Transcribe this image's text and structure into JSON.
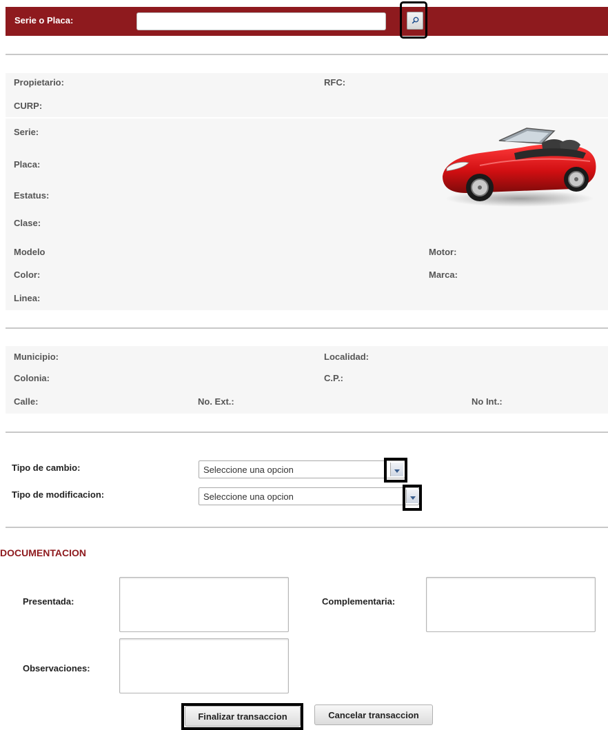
{
  "search": {
    "label": "Serie o Placa:",
    "value": "",
    "placeholder": "",
    "button_icon": "search-icon"
  },
  "owner": {
    "propietario": "Propietario:",
    "rfc": "RFC:",
    "curp": "CURP:"
  },
  "vehicle": {
    "serie": "Serie:",
    "placa": "Placa:",
    "estatus": "Estatus:",
    "clase": "Clase:",
    "modelo": "Modelo",
    "motor": "Motor:",
    "color": "Color:",
    "marca": "Marca:",
    "linea": "Linea:",
    "image": "red-convertible-car"
  },
  "address": {
    "municipio": "Municipio:",
    "localidad": "Localidad:",
    "colonia": "Colonia:",
    "cp": "C.P.:",
    "calle": "Calle:",
    "no_ext": "No. Ext.:",
    "no_int": "No Int.:"
  },
  "form": {
    "tipo_cambio_label": "Tipo de cambio:",
    "tipo_cambio_value": "Seleccione una opcion",
    "tipo_modificacion_label": "Tipo de modificacion:",
    "tipo_modificacion_value": "Seleccione una opcion"
  },
  "documentacion": {
    "title": "DOCUMENTACION",
    "presentada": "Presentada:",
    "complementaria": "Complementaria:",
    "observaciones": "Observaciones:"
  },
  "buttons": {
    "finalizar": "Finalizar transaccion",
    "cancelar": "Cancelar transaccion"
  },
  "colors": {
    "brand": "#8e1a1e",
    "panel_bg": "#f6f6f6",
    "divider": "#c8c8c8"
  }
}
